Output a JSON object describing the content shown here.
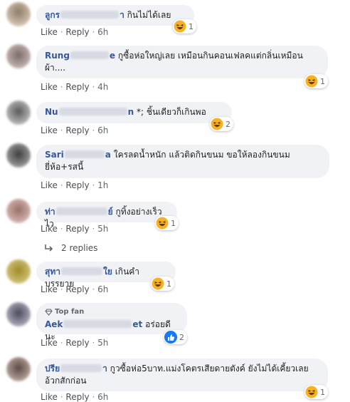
{
  "actions": {
    "like": "Like",
    "reply": "Reply",
    "separator": "·"
  },
  "comments": [
    {
      "name_start": "ลูกร",
      "name_end": "า",
      "text": "กินไม่ได้เลย",
      "time": "6h",
      "reaction": "haha",
      "reactions": "1"
    },
    {
      "name_start": "Rung",
      "name_end": "e",
      "text": "กูซื้อห่อใหญ่เลย เหมือนกินคอนเฟลคแต่กลิ่นเหมือนผ้า....",
      "time": "4h",
      "reaction": "haha",
      "reactions": "1"
    },
    {
      "name_start": "Nu",
      "name_end": "n",
      "text": "*; ชิ้นเดียวก็เกินพอ",
      "time": "6h",
      "reaction": "haha",
      "reactions": "2"
    },
    {
      "name_start": "Sari",
      "name_end": "a",
      "text": "ใครลดน้ำหนัก แล้วติดกินขนม ขอให้ลองกินขนมยี่ห้อ+รสนี้",
      "time": "1h",
      "reaction": "",
      "reactions": ""
    },
    {
      "name_start": "ท่า",
      "name_end": "ย์",
      "text": "กูทิ้งอย่างเร็วไว",
      "time": "5h",
      "reaction": "haha",
      "reactions": "1"
    },
    {
      "name_start": "สุทา",
      "name_end": "ใย",
      "text": "เกินคำบรรยาย",
      "time": "6h",
      "reaction": "haha",
      "reactions": "1"
    },
    {
      "name_start": "Aek",
      "name_end": "et",
      "text": "อร่อยดีนะ",
      "time": "5h",
      "reaction": "like",
      "reactions": "2",
      "badge": "Top fan"
    },
    {
      "name_start": "ปรีย",
      "name_end": "า",
      "text": "กูวซื้อห่อ5บาท.แม่งโคตรเสียดายตังค์ ยังไม่ได้เคี้ยวเลยอ้วกสักก่อน",
      "time": "6h",
      "reaction": "haha",
      "reactions": "1"
    }
  ],
  "replies_link": "2 replies",
  "colors": {
    "name": "#385898",
    "bubble": "#f0f2f5",
    "like_blue": "#1877f2",
    "haha_yellow": "#f7b125"
  },
  "icons": {
    "haha": "haha-emoji-icon",
    "like": "like-thumb-icon",
    "reply_arrow": "reply-arrow-icon",
    "top_fan": "top-fan-badge-icon"
  }
}
